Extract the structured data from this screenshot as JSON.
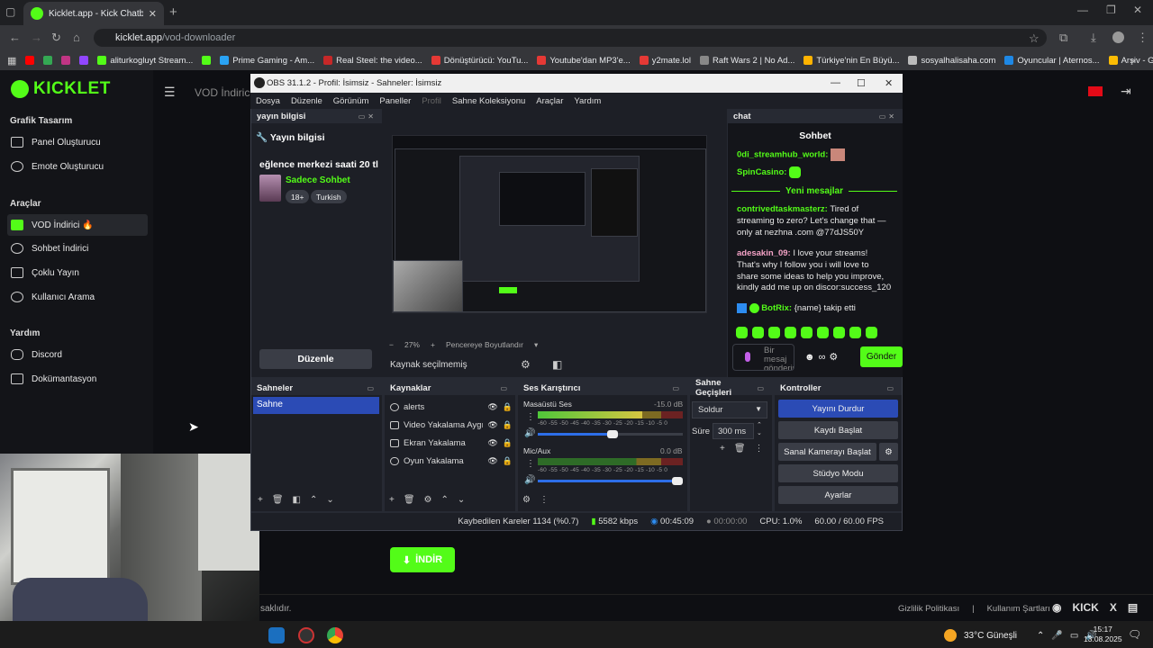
{
  "browser": {
    "tab_title": "Kicklet.app - Kick Chatbot and",
    "url_host": "kicklet.app",
    "url_path": "/vod-downloader",
    "bookmarks": [
      {
        "label": "",
        "color": "#ff0000"
      },
      {
        "label": "",
        "color": "#34a853"
      },
      {
        "label": "",
        "color": "#c13584"
      },
      {
        "label": "",
        "color": "#9146ff"
      },
      {
        "label": "aliturkogluyt Stream...",
        "color": "#53fc18"
      },
      {
        "label": "",
        "color": "#53fc18"
      },
      {
        "label": "Prime Gaming - Am...",
        "color": "#2aa3f4"
      },
      {
        "label": "Real Steel: the video...",
        "color": "#c62828"
      },
      {
        "label": "Dönüştürücü: YouTu...",
        "color": "#e53935"
      },
      {
        "label": "Youtube'dan MP3'e...",
        "color": "#e53935"
      },
      {
        "label": "y2mate.lol",
        "color": "#e53935"
      },
      {
        "label": "Raft Wars 2 | No Ad...",
        "color": "#888888"
      },
      {
        "label": "Türkiye'nin En Büyü...",
        "color": "#ffb300"
      },
      {
        "label": "sosyalhalisaha.com",
        "color": "#bbbbbb"
      },
      {
        "label": "Oyuncular | Aternos...",
        "color": "#1e88e5"
      },
      {
        "label": "Arşiv - Google Foto...",
        "color": "#fbbc04"
      }
    ]
  },
  "kicklet": {
    "logo": "KICKLET",
    "page_title": "VOD İndirici",
    "sections": [
      {
        "title": "Grafik Tasarım",
        "items": [
          "Panel Oluşturucu",
          "Emote Oluşturucu"
        ]
      },
      {
        "title": "Araçlar",
        "items": [
          "VOD İndirici 🔥",
          "Sohbet İndirici",
          "Çoklu Yayın",
          "Kullanıcı Arama"
        ]
      },
      {
        "title": "Yardım",
        "items": [
          "Discord",
          "Dokümantasyon"
        ]
      }
    ],
    "download_button": "İNDİR",
    "footer_left": "saklıdır.",
    "footer_privacy": "Gizlilik Politikası",
    "footer_sep": "|",
    "footer_terms": "Kullanım Şartları",
    "social": [
      "KICK",
      "X"
    ]
  },
  "obs": {
    "title": "OBS 31.1.2 - Profil: İsimsiz - Sahneler: İsimsiz",
    "menu": [
      "Dosya",
      "Düzenle",
      "Görünüm",
      "Paneller",
      "Profil",
      "Sahne Koleksiyonu",
      "Araçlar",
      "Yardım"
    ],
    "stream_info": {
      "dock_title": "yayın bilgisi",
      "header": "Yayın bilgisi",
      "stream_title": "eğlence merkezi saati 20 tl",
      "category": "Sadece Sohbet",
      "tags": [
        "18+",
        "Turkish"
      ],
      "edit_button": "Düzenle"
    },
    "preview": {
      "zoom_minus": "−",
      "zoom": "27%",
      "zoom_plus": "+",
      "fit_label": "Pencereye Boyutlandır",
      "no_source": "Kaynak seçilmemiş"
    },
    "chat": {
      "dock_title": "chat",
      "header": "Sohbet",
      "messages_top": [
        {
          "user": "0di_streamhub_world:",
          "text": "",
          "color": "#53fc18"
        },
        {
          "user": "SpinCasino:",
          "text": "",
          "color": "#53fc18"
        }
      ],
      "new_messages": "Yeni mesajlar",
      "messages": [
        {
          "user": "contrivedtaskmasterz:",
          "text": " Tired of streaming to zero? Let's change that — only at nezhna .com @77dJS50Y",
          "color": "#53fc18"
        },
        {
          "user": "adesakin_09:",
          "text": " I love your streams! That's why I follow you i will love to share some ideas to help you improve, kindly add me up on discor:success_120",
          "color": "#f5a3c7"
        },
        {
          "user": "BotRix:",
          "text": " {name} takip etti",
          "color": "#53fc18"
        }
      ],
      "input_placeholder": "Bir mesaj gönderin",
      "send_button": "Gönder"
    },
    "scenes": {
      "title": "Sahneler",
      "items": [
        "Sahne"
      ]
    },
    "sources": {
      "title": "Kaynaklar",
      "items": [
        "alerts",
        "Video Yakalama Aygıtı",
        "Ekran Yakalama",
        "Oyun Yakalama"
      ]
    },
    "mixer": {
      "title": "Ses Karıştırıcı",
      "channels": [
        {
          "name": "Masaüstü Ses",
          "db": "-15.0 dB",
          "level": 0.72,
          "volume": 0.55
        },
        {
          "name": "Mic/Aux",
          "db": "0.0 dB",
          "level": 0.0,
          "volume": 1.0
        }
      ],
      "ticks": "-60 -55 -50 -45 -40 -35 -30 -25 -20 -15 -10 -5 0"
    },
    "transitions": {
      "title": "Sahne Geçişleri",
      "selected": "Soldur",
      "duration_label": "Süre",
      "duration": "300 ms"
    },
    "controls": {
      "title": "Kontroller",
      "buttons": [
        "Yayını Durdur",
        "Kaydı Başlat",
        "Sanal Kamerayı Başlat",
        "Stüdyo Modu",
        "Ayarlar"
      ]
    },
    "status": {
      "dropped": "Kaybedilen Kareler 1134 (%0.7)",
      "bitrate": "5582 kbps",
      "stream_time": "00:45:09",
      "rec_time": "00:00:00",
      "cpu": "CPU: 1.0%",
      "fps": "60.00 / 60.00 FPS"
    }
  },
  "taskbar": {
    "weather": "33°C  Güneşli",
    "time": "15:17",
    "date": "13.08.2025"
  }
}
